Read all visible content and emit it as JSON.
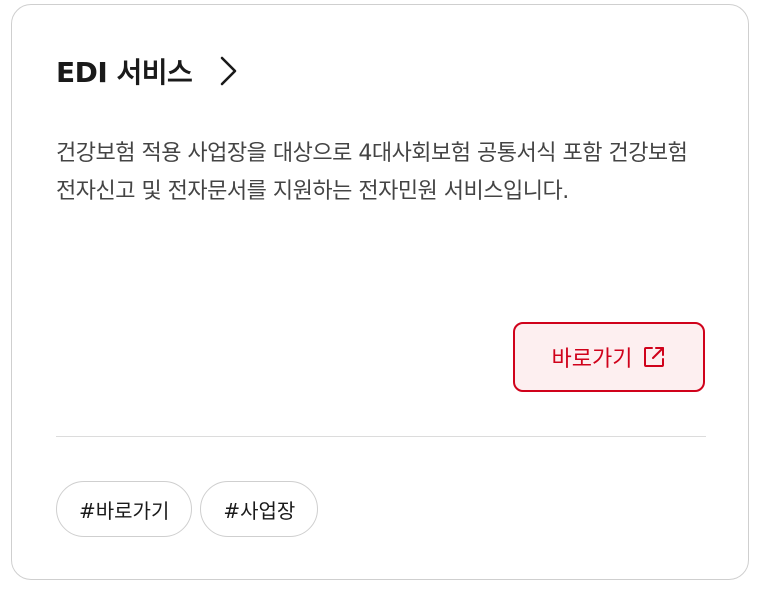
{
  "card": {
    "title": "EDI 서비스",
    "title_icon": "chevron-right-icon",
    "description": "건강보험 적용 사업장을 대상으로 4대사회보험 공통서식 포함 건강보험 전자신고 및 전자문서를 지원하는 전자민원 서비스입니다.",
    "go_button": {
      "label": "바로가기",
      "icon": "external-link-icon"
    },
    "tags": [
      {
        "label": "#바로가기"
      },
      {
        "label": "#사업장"
      }
    ]
  },
  "colors": {
    "accent": "#d0021b",
    "accent_bg": "#fdeff0",
    "text": "#1a1a1a",
    "muted_text": "#444444",
    "border": "#cfcfcf"
  }
}
